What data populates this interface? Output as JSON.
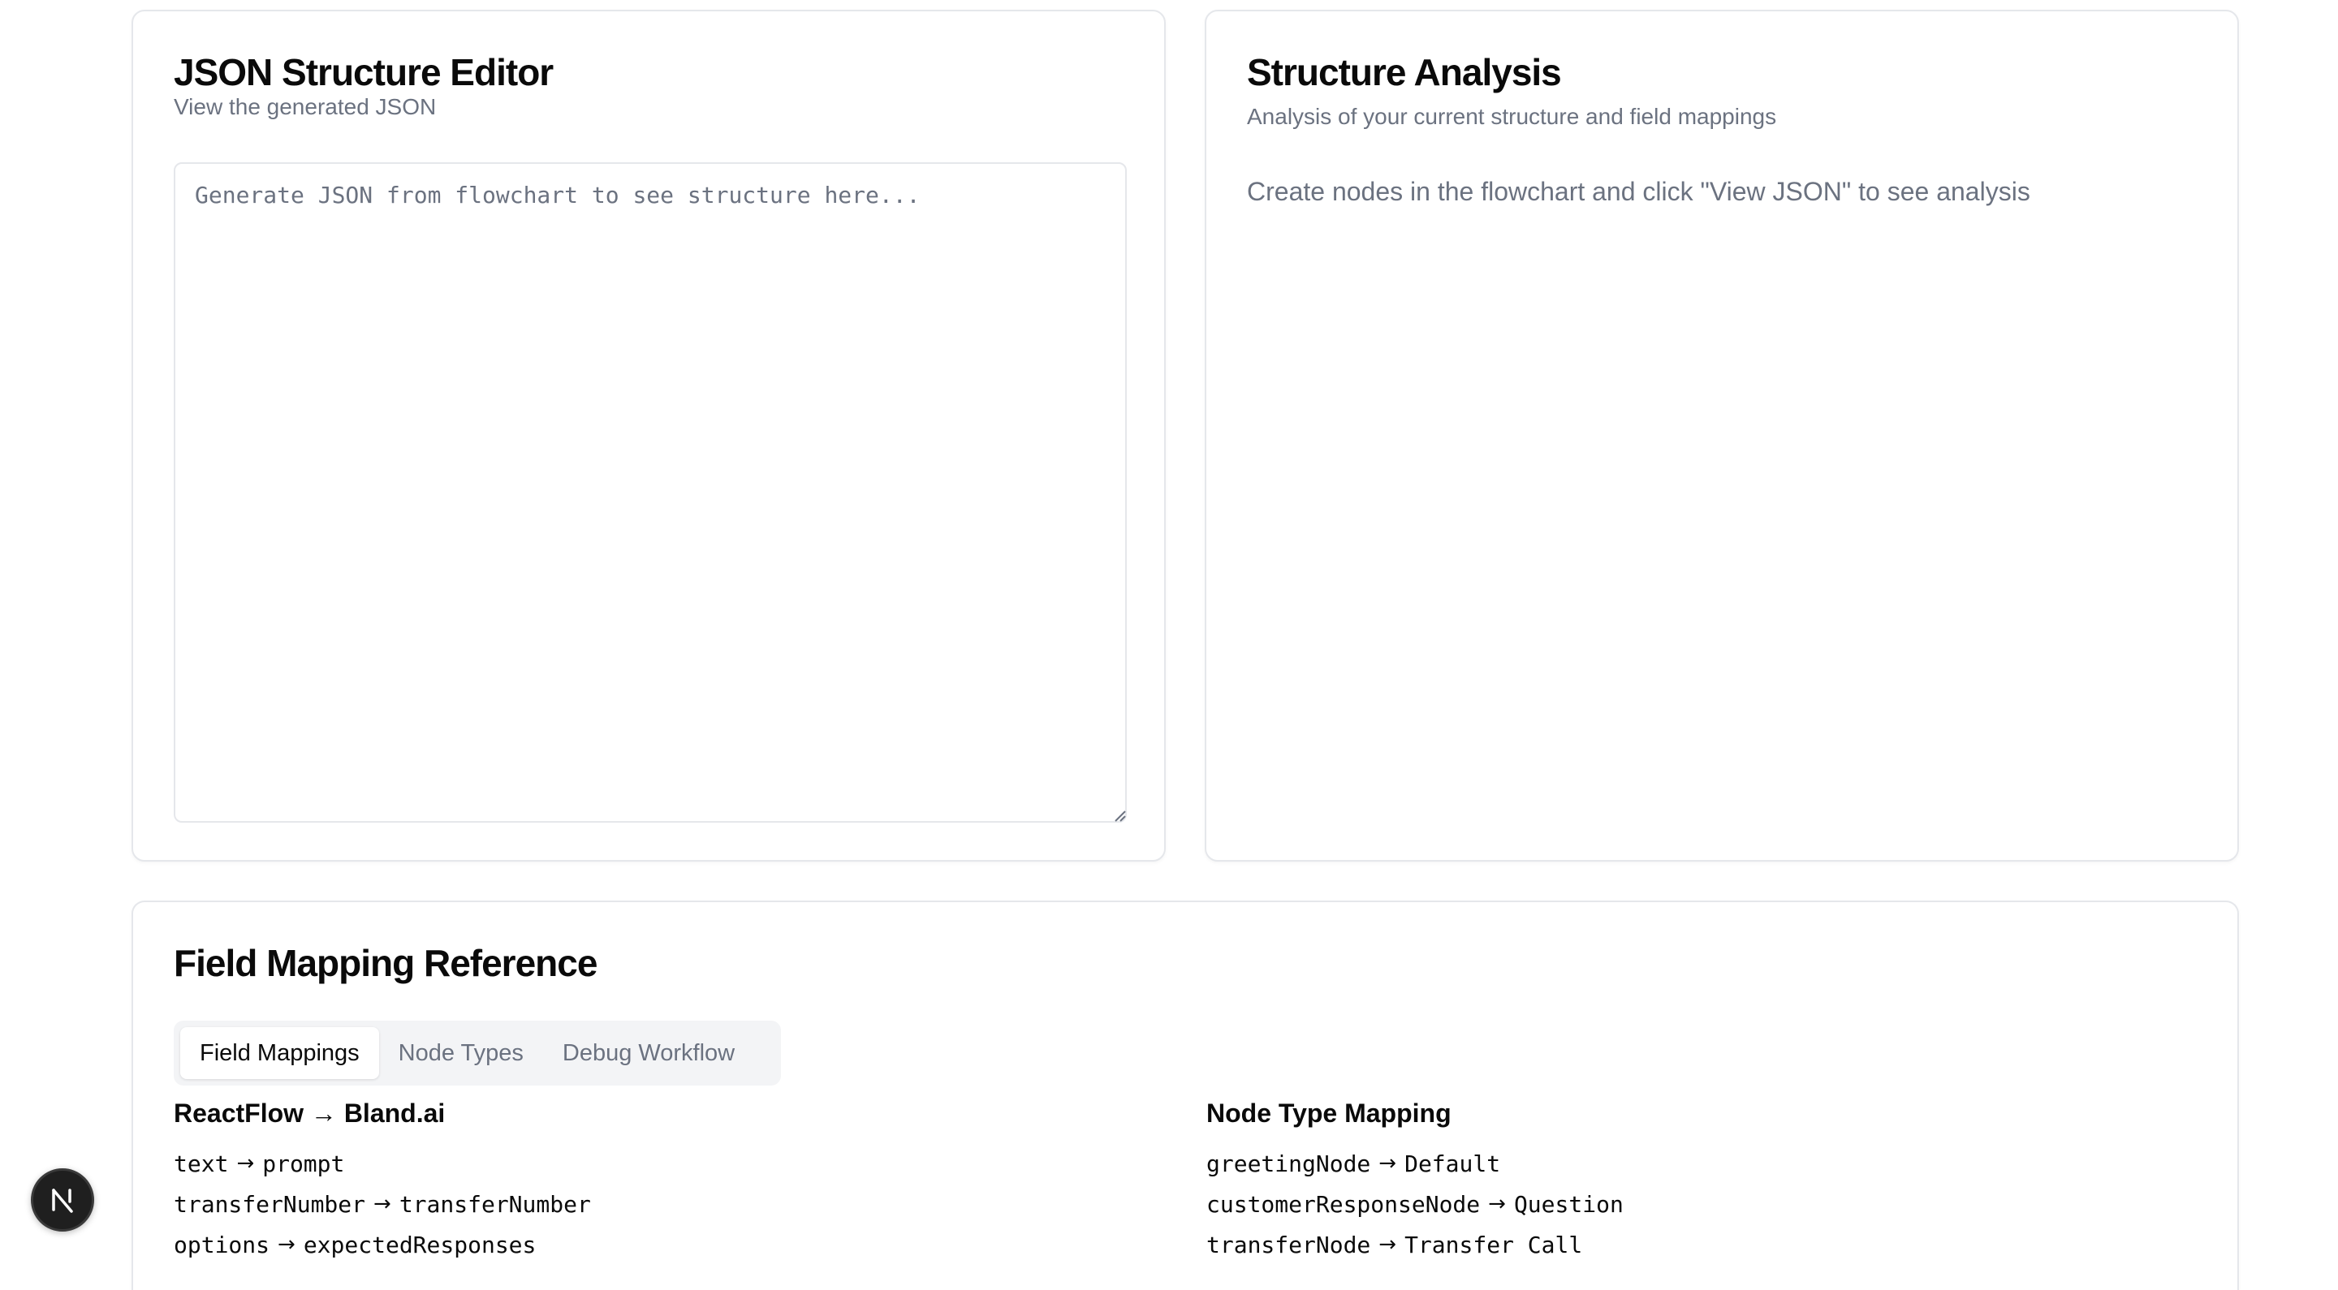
{
  "editor": {
    "title": "JSON Structure Editor",
    "subtitle": "View the generated JSON",
    "textarea_value": "",
    "textarea_placeholder": "Generate JSON from flowchart to see structure here..."
  },
  "analysis": {
    "title": "Structure Analysis",
    "subtitle": "Analysis of your current structure and field mappings",
    "empty_message": "Create nodes in the flowchart and click \"View JSON\" to see analysis"
  },
  "reference": {
    "title": "Field Mapping Reference",
    "tabs": [
      {
        "label": "Field Mappings",
        "active": true
      },
      {
        "label": "Node Types",
        "active": false
      },
      {
        "label": "Debug Workflow",
        "active": false
      }
    ],
    "field_mappings": {
      "heading": "ReactFlow → Bland.ai",
      "rows": [
        {
          "from": "text",
          "to": "prompt"
        },
        {
          "from": "transferNumber",
          "to": "transferNumber"
        },
        {
          "from": "options",
          "to": "expectedResponses"
        }
      ]
    },
    "node_type_mapping": {
      "heading": "Node Type Mapping",
      "rows": [
        {
          "from": "greetingNode",
          "to": "Default"
        },
        {
          "from": "customerResponseNode",
          "to": "Question"
        },
        {
          "from": "transferNode",
          "to": "Transfer Call"
        }
      ]
    },
    "arrow": "→"
  },
  "badge": {
    "letter": "N"
  },
  "colors": {
    "border": "#e5e7eb",
    "muted_text": "#6b7280",
    "tab_background": "#f3f4f6",
    "badge_background": "#1f1f1f"
  }
}
